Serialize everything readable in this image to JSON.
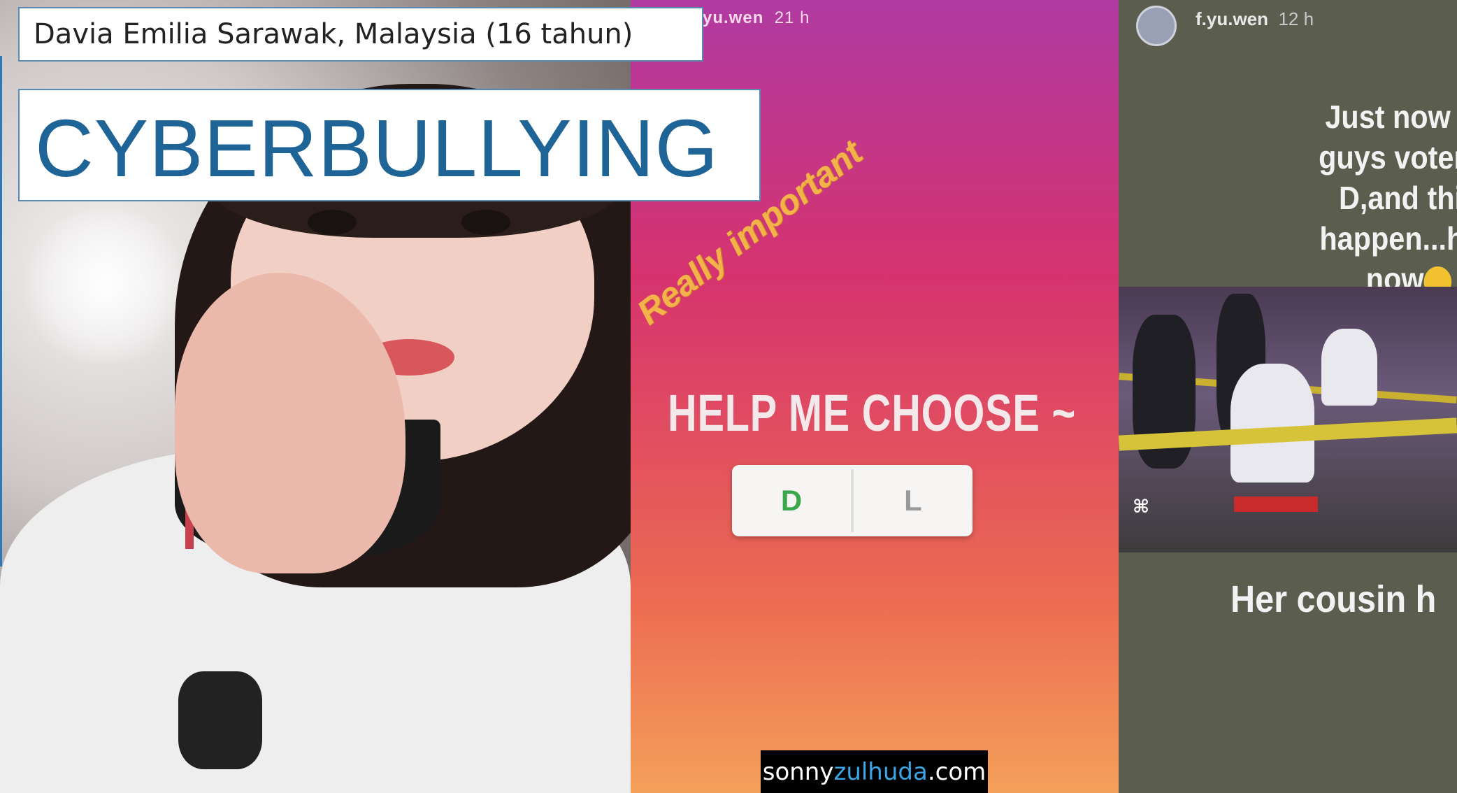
{
  "subject_caption": "Davia Emilia Sarawak, Malaysia (16 tahun)",
  "title": "CYBERBULLYING",
  "story_left": {
    "username": "yu.wen",
    "time": "21 h",
    "sticker_text": "Really important",
    "poll_question": "HELP ME CHOOSE ~",
    "poll_options": [
      "D",
      "L"
    ]
  },
  "story_right": {
    "username": "f.yu.wen",
    "time": "12 h",
    "caption_lines": [
      "Just now yo",
      "guys voters f",
      "D,and this",
      "happen...hap",
      "now"
    ],
    "bottom_caption": "Her cousin h"
  },
  "watermark": {
    "prefix": "sonny",
    "accent": "zulhuda",
    "suffix": ".com"
  },
  "colors": {
    "title_text": "#1f6496",
    "box_border": "#5b8ab0",
    "watermark_accent": "#3aa6e6",
    "poll_option_d": "#3aa84a",
    "poll_option_l": "#9a9a9a"
  }
}
